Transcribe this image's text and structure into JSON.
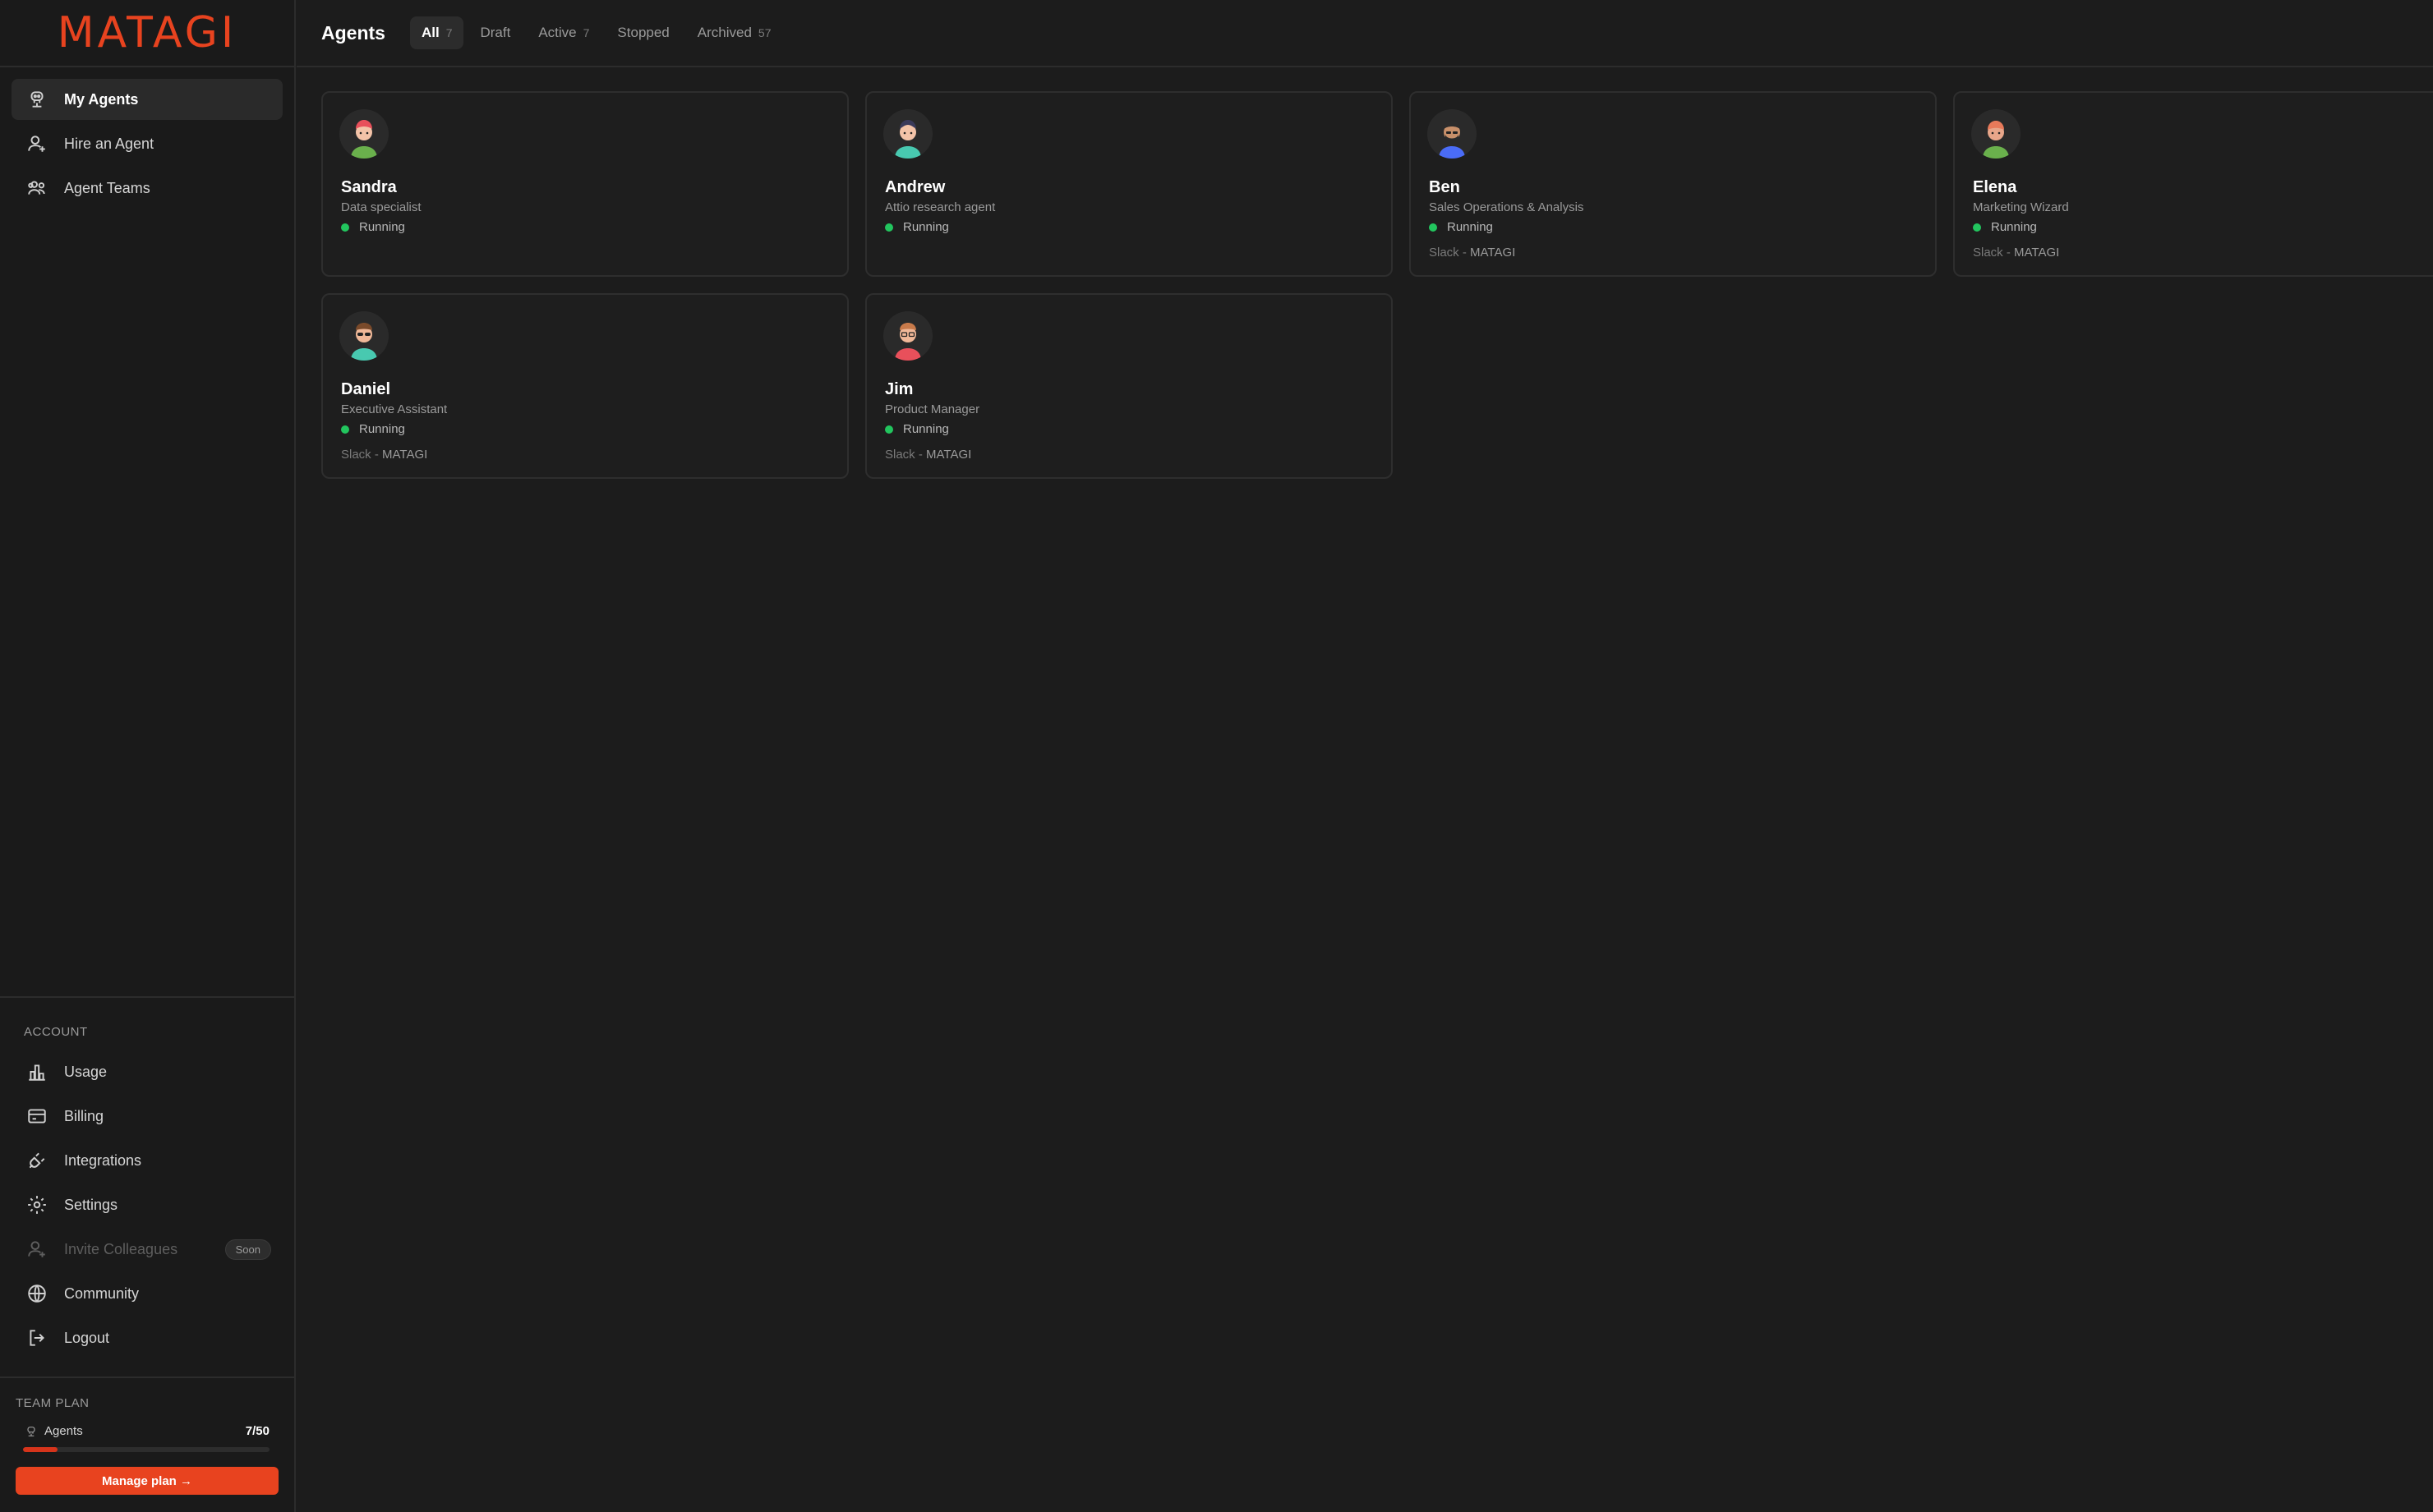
{
  "brand": {
    "logo_text": "MATAGI",
    "accent": "#e8431f"
  },
  "sidebar": {
    "nav": [
      {
        "label": "My Agents",
        "icon": "robot-icon",
        "active": true
      },
      {
        "label": "Hire an Agent",
        "icon": "user-plus-icon",
        "active": false
      },
      {
        "label": "Agent Teams",
        "icon": "users-icon",
        "active": false
      }
    ],
    "account_label": "ACCOUNT",
    "account_nav": [
      {
        "label": "Usage",
        "icon": "bar-chart-icon"
      },
      {
        "label": "Billing",
        "icon": "credit-card-icon"
      },
      {
        "label": "Integrations",
        "icon": "plug-icon"
      },
      {
        "label": "Settings",
        "icon": "gear-icon"
      },
      {
        "label": "Invite Colleagues",
        "icon": "user-plus-icon",
        "badge": "Soon"
      },
      {
        "label": "Community",
        "icon": "globe-icon"
      },
      {
        "label": "Logout",
        "icon": "logout-icon"
      }
    ],
    "plan": {
      "label": "TEAM PLAN",
      "agents_label": "Agents",
      "agents_count": "7/50",
      "usage_fraction": 0.14,
      "manage_label": "Manage plan →"
    }
  },
  "header": {
    "title": "Agents",
    "tabs": [
      {
        "label": "All",
        "count": "7",
        "active": true
      },
      {
        "label": "Draft",
        "count": "",
        "active": false
      },
      {
        "label": "Active",
        "count": "7",
        "active": false
      },
      {
        "label": "Stopped",
        "count": "",
        "active": false
      },
      {
        "label": "Archived",
        "count": "57",
        "active": false
      }
    ]
  },
  "agents": [
    {
      "name": "Sandra",
      "role": "Data specialist",
      "status": "Running",
      "integration_prefix": "",
      "integration_workspace": ""
    },
    {
      "name": "Andrew",
      "role": "Attio research agent",
      "status": "Running",
      "integration_prefix": "",
      "integration_workspace": ""
    },
    {
      "name": "Ben",
      "role": "Sales Operations & Analysis",
      "status": "Running",
      "integration_prefix": "Slack - ",
      "integration_workspace": "MATAGI"
    },
    {
      "name": "Elena",
      "role": "Marketing Wizard",
      "status": "Running",
      "integration_prefix": "Slack - ",
      "integration_workspace": "MATAGI"
    },
    {
      "name": "Daniel",
      "role": "Executive Assistant",
      "status": "Running",
      "integration_prefix": "Slack - ",
      "integration_workspace": "MATAGI"
    },
    {
      "name": "Jim",
      "role": "Product Manager",
      "status": "Running",
      "integration_prefix": "Slack - ",
      "integration_workspace": "MATAGI"
    }
  ],
  "colors": {
    "running": "#22c55e",
    "background": "#1c1c1c",
    "card": "#1e1e1e"
  }
}
